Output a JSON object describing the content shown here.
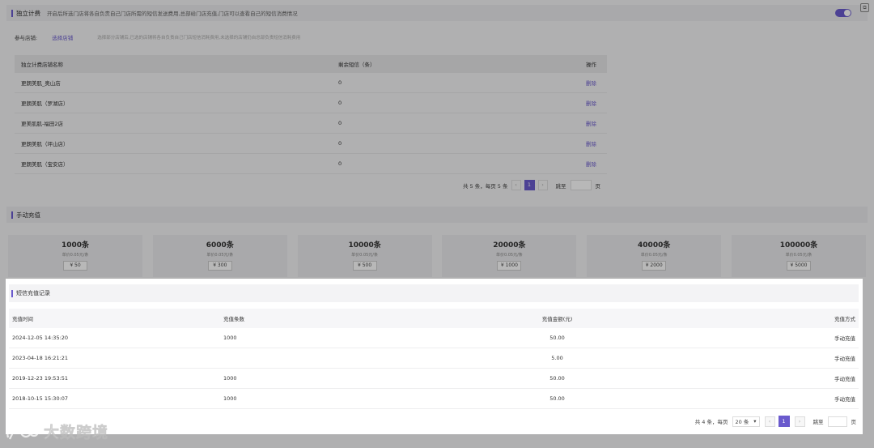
{
  "independent_billing": {
    "title": "独立计费",
    "description": "开启后所选门店将各自负责自己门店所需的短信发送费用,总部给门店充值,门店可以查看自己的短信消费情况",
    "toggle_on": true,
    "participating_label": "参与店铺:",
    "select_link": "选择店铺",
    "select_hint": "选择部分店铺后,已选的店铺将各自负责自己门店短信消耗费用,未选择的店铺仍自总部负责短信消耗费用",
    "table": {
      "headers": [
        "独立计费店铺名称",
        "剩余短信（条）",
        "操作"
      ],
      "rows": [
        {
          "name": "更朗美肌_奥山店",
          "remaining": "0",
          "action": "删除"
        },
        {
          "name": "更朗美肌（罗湖店）",
          "remaining": "0",
          "action": "删除"
        },
        {
          "name": "更美肌肌-福田2店",
          "remaining": "0",
          "action": "删除"
        },
        {
          "name": "更朗美肌（坪山店）",
          "remaining": "0",
          "action": "删除"
        },
        {
          "name": "更朗美肌（宝安店）",
          "remaining": "0",
          "action": "删除"
        }
      ]
    },
    "pager": {
      "summary": "共 5 条，每页 5 条",
      "current_page": "1",
      "jump_label": "跳至",
      "page_suffix": "页"
    }
  },
  "manual_recharge": {
    "title": "手动充值",
    "packages": [
      {
        "count": "1000条",
        "unit": "单价0.05元/条",
        "price": "¥ 50"
      },
      {
        "count": "6000条",
        "unit": "单价0.05元/条",
        "price": "¥ 300"
      },
      {
        "count": "10000条",
        "unit": "单价0.05元/条",
        "price": "¥ 500"
      },
      {
        "count": "20000条",
        "unit": "单价0.05元/条",
        "price": "¥ 1000"
      },
      {
        "count": "40000条",
        "unit": "单价0.05元/条",
        "price": "¥ 2000"
      },
      {
        "count": "100000条",
        "unit": "单价0.05元/条",
        "price": "¥ 5000"
      }
    ]
  },
  "recharge_records": {
    "title": "短信充值记录",
    "headers": [
      "充值时间",
      "充值条数",
      "充值金额(元)",
      "充值方式"
    ],
    "rows": [
      {
        "time": "2024-12-05 14:35:20",
        "count": "1000",
        "amount": "50.00",
        "method": "手动充值"
      },
      {
        "time": "2023-04-18 16:21:21",
        "count": "",
        "amount": "5.00",
        "method": "手动充值"
      },
      {
        "time": "2019-12-23 19:53:51",
        "count": "1000",
        "amount": "50.00",
        "method": "手动充值"
      },
      {
        "time": "2018-10-15 15:30:07",
        "count": "1000",
        "amount": "50.00",
        "method": "手动充值"
      }
    ],
    "pager": {
      "summary": "共 4 条，每页",
      "page_size": "20 条",
      "current_page": "1",
      "jump_label": "跳至",
      "page_suffix": "页"
    }
  },
  "watermark": {
    "text": "大数跨境"
  },
  "colors": {
    "accent": "#6a5acd"
  }
}
